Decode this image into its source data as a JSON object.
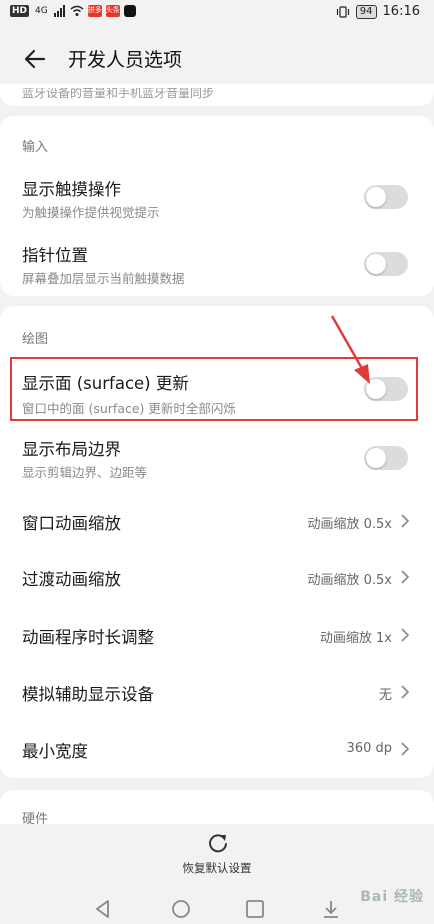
{
  "status_bar": {
    "left_badge": "HD",
    "signal": "4G",
    "app_1": "拼多",
    "app_2": "头条",
    "battery": "94",
    "time": "16:16"
  },
  "header": {
    "title": "开发人员选项",
    "back_icon": "arrow-left-icon"
  },
  "cut_text": "蓝牙设备的音量和手机蓝牙音量同步",
  "input_section": {
    "label": "输入",
    "items": [
      {
        "title": "显示触摸操作",
        "subtitle": "为触摸操作提供视觉提示",
        "enabled": false
      },
      {
        "title": "指针位置",
        "subtitle": "屏幕叠加层显示当前触摸数据",
        "enabled": false
      }
    ]
  },
  "drawing_section": {
    "label": "绘图",
    "toggle_items": [
      {
        "title": "显示面 (surface) 更新",
        "subtitle": "窗口中的面 (surface) 更新时全部闪烁",
        "enabled": false
      },
      {
        "title": "显示布局边界",
        "subtitle": "显示剪辑边界、边距等",
        "enabled": false
      }
    ],
    "value_items": [
      {
        "title": "窗口动画缩放",
        "value": "动画缩放 0.5x"
      },
      {
        "title": "过渡动画缩放",
        "value": "动画缩放 0.5x"
      },
      {
        "title": "动画程序时长调整",
        "value": "动画缩放 1x"
      },
      {
        "title": "模拟辅助显示设备",
        "value": "无"
      },
      {
        "title": "最小宽度",
        "value": "360 dp"
      }
    ]
  },
  "hardware_section": {
    "label": "硬件"
  },
  "restore": {
    "label": "恢复默认设置"
  },
  "annotation_color": "#e23b3b",
  "watermark": "Bai 经验"
}
